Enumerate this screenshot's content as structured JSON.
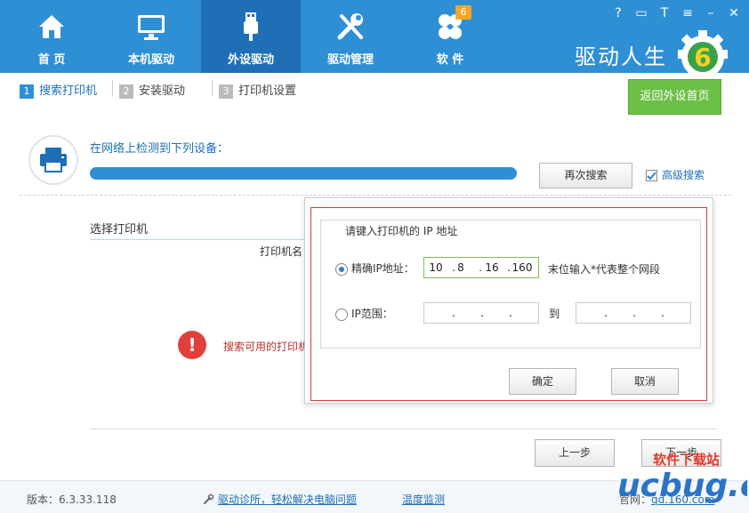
{
  "nav": {
    "items": [
      {
        "label": "首 页",
        "icon": "home-icon"
      },
      {
        "label": "本机驱动",
        "icon": "monitor-icon"
      },
      {
        "label": "外设驱动",
        "icon": "usb-icon"
      },
      {
        "label": "驱动管理",
        "icon": "tools-icon"
      },
      {
        "label": "软 件",
        "icon": "apps-icon",
        "badge": "6"
      }
    ],
    "active_index": 2
  },
  "brand": {
    "text": "驱动人生",
    "logo_digit": "6"
  },
  "window_controls": {
    "help": "?",
    "message": "▭",
    "skin": "T",
    "menu": "≡",
    "minimize": "–",
    "close": "✕"
  },
  "steps": [
    {
      "num": "1",
      "text": "搜索打印机"
    },
    {
      "num": "2",
      "text": "安装驱动"
    },
    {
      "num": "3",
      "text": "打印机设置"
    }
  ],
  "back_button": "返回外设首页",
  "detect": {
    "title": "在网络上检测到下列设备：",
    "search_again": "再次搜索",
    "advanced": "高级搜索",
    "progress": 1.0
  },
  "select": {
    "title": "选择打印机",
    "column": "打印机名",
    "warning_icon": "!",
    "warning": "搜索可用的打印机"
  },
  "dialog": {
    "legend": "请键入打印机的 IP 地址",
    "exact_label": "精确IP地址：",
    "exact_ip": [
      "10",
      "8",
      "16",
      "160"
    ],
    "exact_hint": "末位输入*代表整个网段",
    "range_label": "IP范围：",
    "range_to": "到",
    "ok": "确定",
    "cancel": "取消"
  },
  "wizard": {
    "prev": "上一步",
    "next": "下一步"
  },
  "footer": {
    "version": "版本：6.3.33.118",
    "clinic_link": "驱动诊所，轻松解决电脑问题",
    "temp_link": "温度监测",
    "site_prefix": "官网：",
    "site": "qd.160.com"
  },
  "watermark": {
    "text": "ucbug.cc",
    "subtitle": "软件下载站"
  },
  "colors": {
    "header": "#2f8fd5",
    "header_active": "#1e6fb5",
    "green": "#6cbf45",
    "alert": "#e0403c"
  }
}
